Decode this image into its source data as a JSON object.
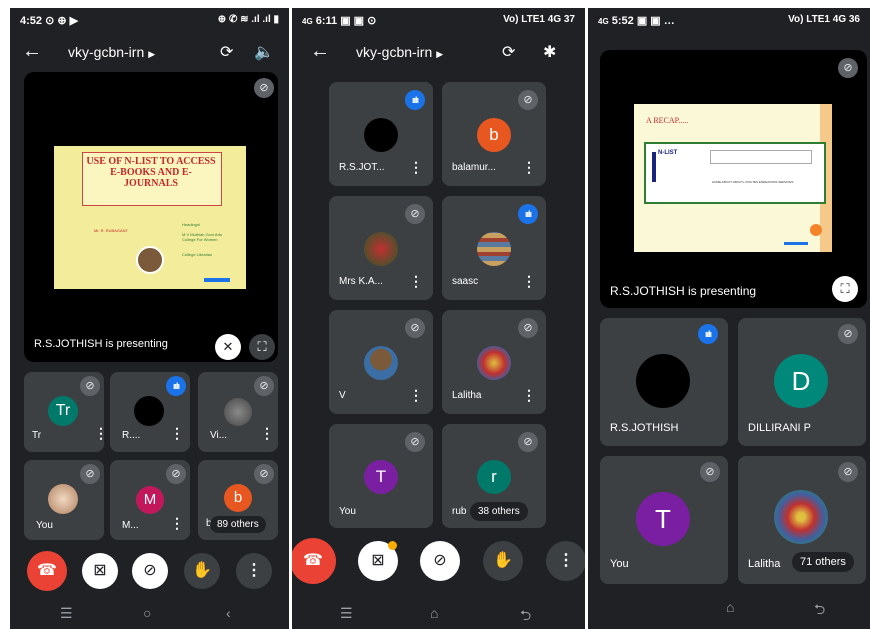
{
  "phones": [
    {
      "status": {
        "time": "4:52",
        "icons": "⊙ ⊕ ▶",
        "right": "⊕ ✆ ≋ .ıl .ıl ▮"
      },
      "meeting_title": "vky-gcbn-irn",
      "presenting_label": "R.S.JOTHISH is presenting",
      "slide": {
        "title": "USE OF N-LIST TO ACCESS E-BOOKS AND E-JOURNALS",
        "presenter_line": "Mr. R. RUBAGANT",
        "right_lines": [
          "Headingol",
          "M.V Muthiah Govt Arts College For Women",
          "College Librarian"
        ]
      },
      "tiles": [
        {
          "name": "Tr",
          "initial": "Tr",
          "color": "#00796b"
        },
        {
          "name": "R....",
          "initial": "",
          "color": "#000000"
        },
        {
          "name": "Vi...",
          "initial": "",
          "color": "#555555"
        },
        {
          "name": "You",
          "initial": "",
          "color": "#d7b8a0"
        },
        {
          "name": "M...",
          "initial": "M",
          "color": "#c2185b"
        },
        {
          "name": "b",
          "initial": "b",
          "color": "#e8571f"
        }
      ],
      "others": "89 others"
    },
    {
      "status": {
        "time": "6:11",
        "net": "4G",
        "right": "Vo) LTE1 4G 37"
      },
      "meeting_title": "vky-gcbn-irn",
      "tiles": [
        {
          "name": "R.S.JOT...",
          "initial": "",
          "color": "#000000"
        },
        {
          "name": "balamur...",
          "initial": "b",
          "color": "#e8571f"
        },
        {
          "name": "Mrs K.A...",
          "initial": "",
          "color": "#8a2a2a"
        },
        {
          "name": "saasc",
          "initial": "",
          "color": "#7a5a3a"
        },
        {
          "name": "V",
          "initial": "",
          "color": "#3a6ea5"
        },
        {
          "name": "Lalitha",
          "initial": "",
          "color": "#7a4aa0"
        },
        {
          "name": "You",
          "initial": "T",
          "color": "#7b1fa2"
        },
        {
          "name": "rub",
          "initial": "r",
          "color": "#00796b"
        }
      ],
      "others": "38 others"
    },
    {
      "status": {
        "time": "5:52",
        "net": "4G",
        "right": "Vo) LTE1 4G 36"
      },
      "presenting_label": "R.S.JOTHISH is presenting",
      "slide": {
        "title": "A RECAP.....",
        "logo": "N-LIST",
        "menu": "HOME  ABOUT  ABOUT+  ROUTES  ENDEAVORS  SERVICES"
      },
      "tiles": [
        {
          "name": "R.S.JOTHISH",
          "initial": "",
          "color": "#000000"
        },
        {
          "name": "DILLIRANI P",
          "initial": "D",
          "color": "#00897b"
        },
        {
          "name": "You",
          "initial": "T",
          "color": "#7b1fa2"
        },
        {
          "name": "Lalitha",
          "initial": "",
          "color": "#7a4aa0"
        }
      ],
      "others": "71 others"
    }
  ]
}
